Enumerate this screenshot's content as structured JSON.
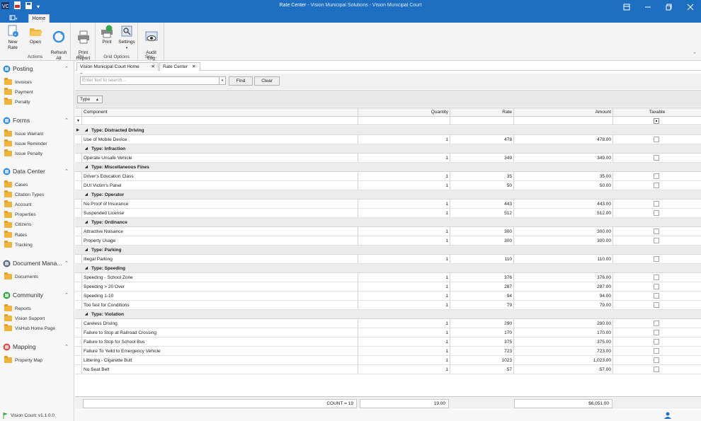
{
  "window": {
    "title": "Rate Center",
    "subtitle": " - Vision Municipal Solutions - Vision Municipal Court"
  },
  "ribbon": {
    "home_tab": "Home",
    "groups": [
      {
        "label": "Actions",
        "buttons": [
          {
            "label": "New Rate",
            "icon": "new-rate-icon"
          },
          {
            "label": "Open",
            "icon": "folder-open-icon"
          },
          {
            "label": "Refresh\nAll",
            "icon": "refresh-icon"
          }
        ]
      },
      {
        "label": "Pri...",
        "buttons": [
          {
            "label": "Print\nReport",
            "icon": "printer-icon"
          }
        ]
      },
      {
        "label": "Grid Options",
        "buttons": [
          {
            "label": "Print",
            "icon": "print-grid-icon"
          },
          {
            "label": "Settings",
            "icon": "settings-icon"
          }
        ]
      },
      {
        "label": "Sec...",
        "buttons": [
          {
            "label": "Audit\nLog",
            "icon": "audit-log-icon"
          }
        ]
      }
    ]
  },
  "sidebar": {
    "sections": [
      {
        "title": "Posting",
        "icon": "posting-icon",
        "items": [
          "Invoices",
          "Payment",
          "Penalty"
        ]
      },
      {
        "title": "Forms",
        "icon": "forms-icon",
        "items": [
          "Issue Warrant",
          "Issue Reminder",
          "Issue Penalty"
        ]
      },
      {
        "title": "Data Center",
        "icon": "data-center-icon",
        "items": [
          "Cases",
          "Citation Types",
          "Account",
          "Properties",
          "Citizens",
          "Rates",
          "Tracking"
        ]
      },
      {
        "title": "Document Mana...",
        "icon": "document-icon",
        "items": [
          "Documents"
        ]
      },
      {
        "title": "Community",
        "icon": "community-icon",
        "items": [
          "Reports",
          "Vision Support",
          "VisHub Home Page"
        ]
      },
      {
        "title": "Mapping",
        "icon": "mapping-icon",
        "items": [
          "Property Map"
        ]
      }
    ],
    "version": "Vision Court: v1.1.0.0"
  },
  "doc_tabs": [
    {
      "label": "Vision Municipal Court Home Page",
      "active": false
    },
    {
      "label": "Rate Center",
      "active": true
    }
  ],
  "search": {
    "placeholder": "Enter text to search...",
    "find_label": "Find",
    "clear_label": "Clear"
  },
  "group_by": "Type",
  "grid": {
    "columns": [
      "Component",
      "Quantity",
      "Rate",
      "Amount",
      "Taxable"
    ],
    "groups": [
      {
        "label": "Type: Distracted Driving",
        "rows": [
          [
            "Use of Mobile Device",
            "1",
            "478",
            "478.00"
          ]
        ]
      },
      {
        "label": "Type: Infraction",
        "rows": [
          [
            "Operate Unsafe Vehicle",
            "1",
            "349",
            "349.00"
          ]
        ]
      },
      {
        "label": "Type: Miscellaneous Fines",
        "rows": [
          [
            "Driver's Education Class",
            "1",
            "35",
            "35.00"
          ],
          [
            "DUI Victim's Panel",
            "1",
            "50",
            "50.00"
          ]
        ]
      },
      {
        "label": "Type: Operator",
        "rows": [
          [
            "No Proof of Insurance",
            "1",
            "443",
            "443.00"
          ],
          [
            "Suspended License",
            "1",
            "512",
            "512.00"
          ]
        ]
      },
      {
        "label": "Type: Ordinance",
        "rows": [
          [
            "Attractive Nuisance",
            "1",
            "300",
            "300.00"
          ],
          [
            "Property Usage",
            "1",
            "300",
            "300.00"
          ]
        ]
      },
      {
        "label": "Type: Parking",
        "rows": [
          [
            "Illegal Parking",
            "1",
            "110",
            "110.00"
          ]
        ]
      },
      {
        "label": "Type: Speeding",
        "rows": [
          [
            "Speeding - School Zone",
            "1",
            "376",
            "376.00"
          ],
          [
            "Speeding > 20 Over",
            "1",
            "287",
            "287.00"
          ],
          [
            "Speeding 1-10",
            "1",
            "94",
            "94.00"
          ],
          [
            "Too fast for Conditions",
            "1",
            "79",
            "79.00"
          ]
        ]
      },
      {
        "label": "Type: Violation",
        "rows": [
          [
            "Careless Driving",
            "1",
            "290",
            "290.00"
          ],
          [
            "Failure to Stop at Railroad Crossing",
            "1",
            "170",
            "170.00"
          ],
          [
            "Failure to Stop for School Bus",
            "1",
            "375",
            "375.00"
          ],
          [
            "Failure To Yeild to Emergency Vehicle",
            "1",
            "723",
            "723.00"
          ],
          [
            "Littering - Cigarette Butt",
            "1",
            "1023",
            "1,023.00"
          ],
          [
            "No Seat Belt",
            "1",
            "57",
            "57.00"
          ]
        ]
      }
    ],
    "footer": {
      "count": "COUNT = 19",
      "quantity_sum": "19.00",
      "amount_sum": "$6,051.00"
    }
  }
}
